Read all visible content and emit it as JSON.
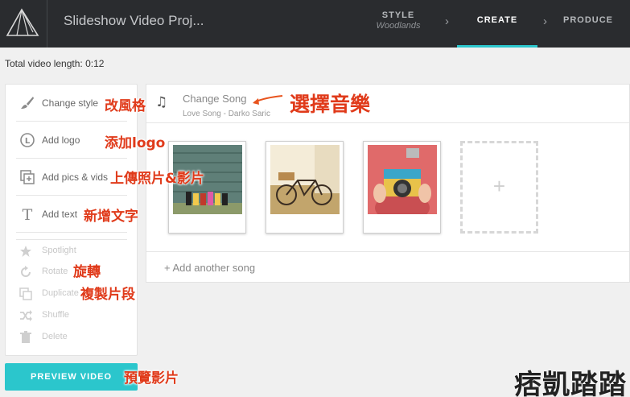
{
  "header": {
    "project_title": "Slideshow Video Proj...",
    "steps": {
      "style": "STYLE",
      "style_sub": "Woodlands",
      "create": "CREATE",
      "produce": "PRODUCE"
    },
    "active_step": "CREATE",
    "accent_color": "#2bc6cc"
  },
  "video_length": "Total video length: 0:12",
  "sidebar": {
    "items": [
      {
        "label": "Change style",
        "icon": "paintbrush-icon"
      },
      {
        "label": "Add logo",
        "icon": "logo-icon"
      },
      {
        "label": "Add pics & vids",
        "icon": "add-media-icon"
      },
      {
        "label": "Add text",
        "icon": "text-icon"
      }
    ],
    "disabled_items": [
      {
        "label": "Spotlight",
        "icon": "star-icon"
      },
      {
        "label": "Rotate",
        "icon": "rotate-icon"
      },
      {
        "label": "Duplicate",
        "icon": "duplicate-icon"
      },
      {
        "label": "Shuffle",
        "icon": "shuffle-icon"
      },
      {
        "label": "Delete",
        "icon": "trash-icon"
      }
    ]
  },
  "song": {
    "title": "Change Song",
    "artist": "Love Song - Darko Saric",
    "add_another": "+ Add another song"
  },
  "thumbnails": [
    "boots-photo",
    "bicycle-photo",
    "camera-photo"
  ],
  "add_tile": "+",
  "preview_button": "PREVIEW VIDEO",
  "annotations": {
    "change_style": "改風格",
    "music_note": "♫",
    "choose_music": "選擇音樂",
    "add_logo": "添加logo",
    "add_pics": "上傳照片&影片",
    "add_text": "新增文字",
    "rotate": "旋轉",
    "duplicate": "複製片段",
    "preview": "預覽影片"
  },
  "watermark": "痞凱踏踏"
}
